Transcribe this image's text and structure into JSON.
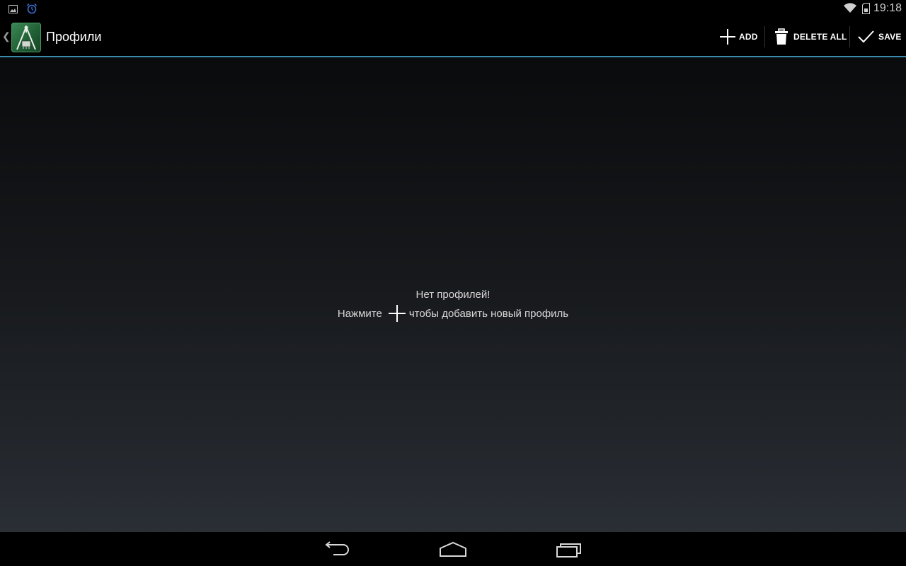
{
  "status_bar": {
    "time": "19:18",
    "icons": [
      "image-icon",
      "alarm-icon",
      "wifi-icon",
      "sd-card-icon"
    ]
  },
  "action_bar": {
    "title": "Профили",
    "actions": {
      "add": "ADD",
      "delete_all": "DELETE ALL",
      "save": "SAVE"
    },
    "accent_color": "#3a8bb0"
  },
  "empty_state": {
    "title": "Нет профилей!",
    "hint_before": "Нажмите",
    "hint_after": "чтобы добавить новый профиль"
  },
  "nav_bar": {
    "buttons": [
      "back-icon",
      "home-icon",
      "recents-icon"
    ]
  }
}
